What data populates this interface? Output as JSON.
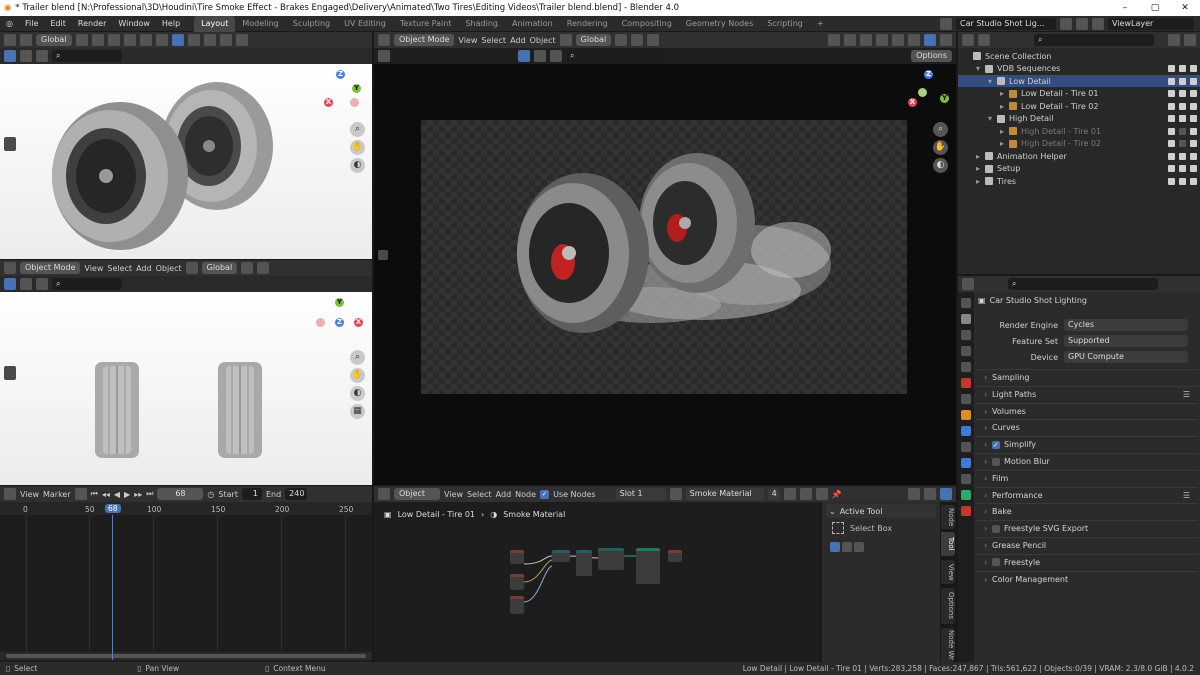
{
  "window": {
    "title": "* Trailer blend [N:\\Professional\\3D\\Houdini\\Tire Smoke Effect - Brakes Engaged\\Delivery\\Animated\\Two Tires\\Editing Videos\\Trailer blend.blend] - Blender 4.0",
    "controls": [
      "–",
      "▢",
      "✕"
    ]
  },
  "menu": {
    "items": [
      "File",
      "Edit",
      "Render",
      "Window",
      "Help"
    ]
  },
  "workspaces": {
    "tabs": [
      "Layout",
      "Modeling",
      "Sculpting",
      "UV Editing",
      "Texture Paint",
      "Shading",
      "Animation",
      "Rendering",
      "Compositing",
      "Geometry Nodes",
      "Scripting"
    ],
    "active": "Layout",
    "add": "+"
  },
  "scene": {
    "name": "Car Studio Shot Lig...",
    "view_layer": "ViewLayer"
  },
  "viewport_top_left": {
    "transform": "Global"
  },
  "viewport_bottom_left": {
    "mode": "Object Mode",
    "menus": [
      "View",
      "Select",
      "Add",
      "Object"
    ],
    "transform": "Global"
  },
  "viewport_main": {
    "mode": "Object Mode",
    "menus": [
      "View",
      "Select",
      "Add",
      "Object"
    ],
    "transform": "Global",
    "options": "Options"
  },
  "outliner": {
    "rows": [
      {
        "label": "Scene Collection",
        "indent": 0,
        "state": "normal"
      },
      {
        "label": "VDB Sequences",
        "indent": 1,
        "state": "normal"
      },
      {
        "label": "Low Detail",
        "indent": 2,
        "state": "selected"
      },
      {
        "label": "Low Detail - Tire 01",
        "indent": 3,
        "state": "normal"
      },
      {
        "label": "Low Detail - Tire 02",
        "indent": 3,
        "state": "normal"
      },
      {
        "label": "High Detail",
        "indent": 2,
        "state": "normal"
      },
      {
        "label": "High Detail - Tire 01",
        "indent": 3,
        "state": "dim"
      },
      {
        "label": "High Detail - Tire 02",
        "indent": 3,
        "state": "dim"
      },
      {
        "label": "Animation Helper",
        "indent": 1,
        "state": "normal"
      },
      {
        "label": "Setup",
        "indent": 1,
        "state": "normal"
      },
      {
        "label": "Tires",
        "indent": 1,
        "state": "normal"
      }
    ]
  },
  "properties": {
    "scene_label": "Car Studio Shot Lighting",
    "render_engine_label": "Render Engine",
    "render_engine": "Cycles",
    "feature_set_label": "Feature Set",
    "feature_set": "Supported",
    "device_label": "Device",
    "device": "GPU Compute",
    "sections": [
      "Sampling",
      "Light Paths",
      "Volumes",
      "Curves",
      "Simplify",
      "Motion Blur",
      "Film",
      "Performance",
      "Bake",
      "Freestyle SVG Export",
      "Grease Pencil",
      "Freestyle",
      "Color Management"
    ]
  },
  "timeline": {
    "menus": [
      "View",
      "Marker"
    ],
    "current_frame": "68",
    "start_label": "Start",
    "start": "1",
    "end_label": "End",
    "end": "240",
    "ticks": [
      "0",
      "50",
      "68",
      "100",
      "150",
      "200",
      "250"
    ]
  },
  "node_editor": {
    "type": "Object",
    "menus": [
      "View",
      "Select",
      "Add",
      "Node"
    ],
    "use_nodes_label": "Use Nodes",
    "slot": "Slot 1",
    "material": "Smoke Material",
    "users": "4",
    "breadcrumb_object": "Low Detail - Tire 01",
    "breadcrumb_material": "Smoke Material"
  },
  "sidebar": {
    "active_tool_label": "Active Tool",
    "select_box": "Select Box",
    "tabs": [
      "Node",
      "Tool",
      "View",
      "Options",
      "Node Wr"
    ]
  },
  "statusbar": {
    "select": "Select",
    "pan_view": "Pan View",
    "context_menu": "Context Menu",
    "stats": "Low Detail | Low Detail - Tire 01 | Verts:283,258 | Faces:247,867 | Tris:561,622 | Objects:0/39 | VRAM: 2.3/8.0 GiB | 4.0.2"
  },
  "colors": {
    "accent": "#4772b3",
    "selection": "#334d80",
    "timeline_cursor": "#5680c2"
  }
}
